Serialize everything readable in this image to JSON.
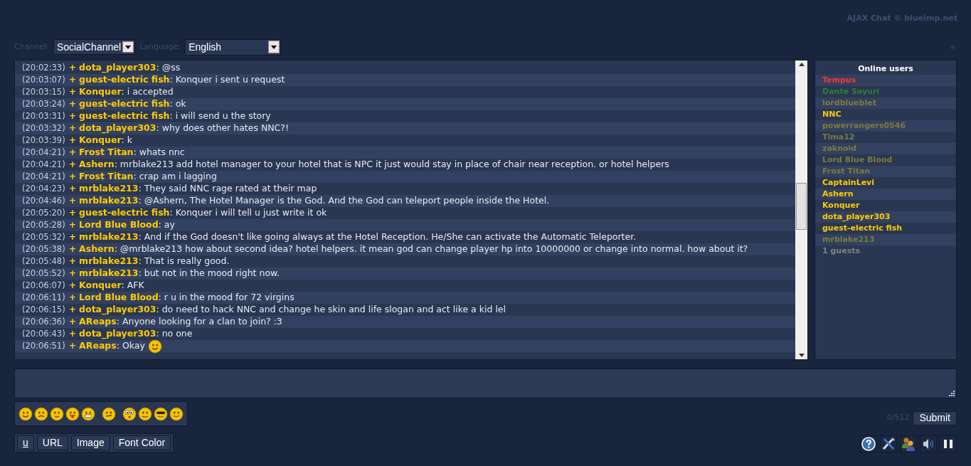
{
  "copyright": "AJAX Chat © blueimp.net",
  "channel": {
    "label": "Channel:",
    "value": "SocialChannel"
  },
  "language": {
    "label": "Language:",
    "value": "English"
  },
  "messages": [
    {
      "time": "(20:02:33)",
      "marker": "+",
      "user": "dota_player303",
      "text": ": @ss",
      "emoticon": false
    },
    {
      "time": "(20:03:07)",
      "marker": "+",
      "user": "guest-electric fish",
      "text": ": Konquer i sent u request",
      "emoticon": false
    },
    {
      "time": "(20:03:15)",
      "marker": "+",
      "user": "Konquer",
      "text": ": i accepted",
      "emoticon": false
    },
    {
      "time": "(20:03:24)",
      "marker": "+",
      "user": "guest-electric fish",
      "text": ": ok",
      "emoticon": false
    },
    {
      "time": "(20:03:31)",
      "marker": "+",
      "user": "guest-electric fish",
      "text": ": i will send u the story",
      "emoticon": false
    },
    {
      "time": "(20:03:32)",
      "marker": "+",
      "user": "dota_player303",
      "text": ": why does other hates NNC?!",
      "emoticon": false
    },
    {
      "time": "(20:03:39)",
      "marker": "+",
      "user": "Konquer",
      "text": ": k",
      "emoticon": false
    },
    {
      "time": "(20:04:21)",
      "marker": "+",
      "user": "Frost Titan",
      "text": ": whats nnc",
      "emoticon": false
    },
    {
      "time": "(20:04:21)",
      "marker": "+",
      "user": "Ashern",
      "text": ": mrblake213 add hotel manager to your hotel that is NPC it just would stay in place of chair near reception. or hotel helpers",
      "emoticon": false
    },
    {
      "time": "(20:04:21)",
      "marker": "+",
      "user": "Frost Titan",
      "text": ": crap am i lagging",
      "emoticon": false
    },
    {
      "time": "(20:04:23)",
      "marker": "+",
      "user": "mrblake213",
      "text": ": They said NNC rage rated at their map",
      "emoticon": false
    },
    {
      "time": "(20:04:46)",
      "marker": "+",
      "user": "mrblake213",
      "text": ": @Ashern, The Hotel Manager is the God. And the God can teleport people inside the Hotel.",
      "emoticon": false
    },
    {
      "time": "(20:05:20)",
      "marker": "+",
      "user": "guest-electric fish",
      "text": ": Konquer i will tell u just write it ok",
      "emoticon": false
    },
    {
      "time": "(20:05:28)",
      "marker": "+",
      "user": "Lord Blue Blood",
      "text": ": ay",
      "emoticon": false
    },
    {
      "time": "(20:05:32)",
      "marker": "+",
      "user": "mrblake213",
      "text": ": And if the God doesn't like going always at the Hotel Reception. He/She can activate the Automatic Teleporter.",
      "emoticon": false
    },
    {
      "time": "(20:05:38)",
      "marker": "+",
      "user": "Ashern",
      "text": ": @mrblake213 how about second idea? hotel helpers. it mean god can change player hp into 10000000 or change into normal. how about it?",
      "emoticon": false
    },
    {
      "time": "(20:05:48)",
      "marker": "+",
      "user": "mrblake213",
      "text": ": That is really good.",
      "emoticon": false
    },
    {
      "time": "(20:05:52)",
      "marker": "+",
      "user": "mrblake213",
      "text": ": but not in the mood right now.",
      "emoticon": false
    },
    {
      "time": "(20:06:07)",
      "marker": "+",
      "user": "Konquer",
      "text": ": AFK",
      "emoticon": false
    },
    {
      "time": "(20:06:11)",
      "marker": "+",
      "user": "Lord Blue Blood",
      "text": ": r u in the mood for 72 virgins",
      "emoticon": false
    },
    {
      "time": "(20:06:15)",
      "marker": "+",
      "user": "dota_player303",
      "text": ": do need to hack NNC and change he skin and life slogan and act like a kid lel",
      "emoticon": false
    },
    {
      "time": "(20:06:36)",
      "marker": "+",
      "user": "AReaps",
      "text": ": Anyone looking for a clan to join? :3",
      "emoticon": false
    },
    {
      "time": "(20:06:43)",
      "marker": "+",
      "user": "dota_player303",
      "text": ": no one",
      "emoticon": false
    },
    {
      "time": "(20:06:51)",
      "marker": "+",
      "user": "AReaps",
      "text": ": Okay",
      "emoticon": true
    }
  ],
  "online_users": {
    "title": "Online users",
    "users": [
      {
        "name": "Tempus",
        "color": "#ff3333"
      },
      {
        "name": "Dante Sayuri",
        "color": "#2e7d32"
      },
      {
        "name": "lordblueblet",
        "color": "#7d7a3c"
      },
      {
        "name": "NNC",
        "color": "#ffcc00"
      },
      {
        "name": "powerrangers0546",
        "color": "#7d7a3c"
      },
      {
        "name": "Tima12",
        "color": "#7d7a3c"
      },
      {
        "name": "zaknoid",
        "color": "#7d7a3c"
      },
      {
        "name": "Lord Blue Blood",
        "color": "#7d7a3c"
      },
      {
        "name": "Frost Titan",
        "color": "#7d7a3c"
      },
      {
        "name": "CaptainLevi",
        "color": "#ffcc00"
      },
      {
        "name": "Ashern",
        "color": "#ffcc00"
      },
      {
        "name": "Konquer",
        "color": "#ffcc00"
      },
      {
        "name": "dota_player303",
        "color": "#ffcc00"
      },
      {
        "name": "guest-electric fish",
        "color": "#ffcc00"
      },
      {
        "name": "mrblake213",
        "color": "#7d7a3c"
      },
      {
        "name": "1 guests",
        "color": "#808080"
      }
    ]
  },
  "counter": "0/512",
  "submit": "Submit",
  "emoticons": [
    {
      "kind": "happy"
    },
    {
      "kind": "sad"
    },
    {
      "kind": "wink"
    },
    {
      "kind": "tongue"
    },
    {
      "kind": "grin"
    },
    {
      "kind": "confused"
    },
    {
      "kind": "surprised"
    },
    {
      "kind": "eyes"
    },
    {
      "kind": "cool"
    },
    {
      "kind": "smile"
    }
  ],
  "format_buttons": [
    {
      "label": "u",
      "underline": true
    },
    {
      "label": "URL",
      "underline": false
    },
    {
      "label": "Image",
      "underline": false
    },
    {
      "label": "Font Color",
      "underline": false
    }
  ]
}
